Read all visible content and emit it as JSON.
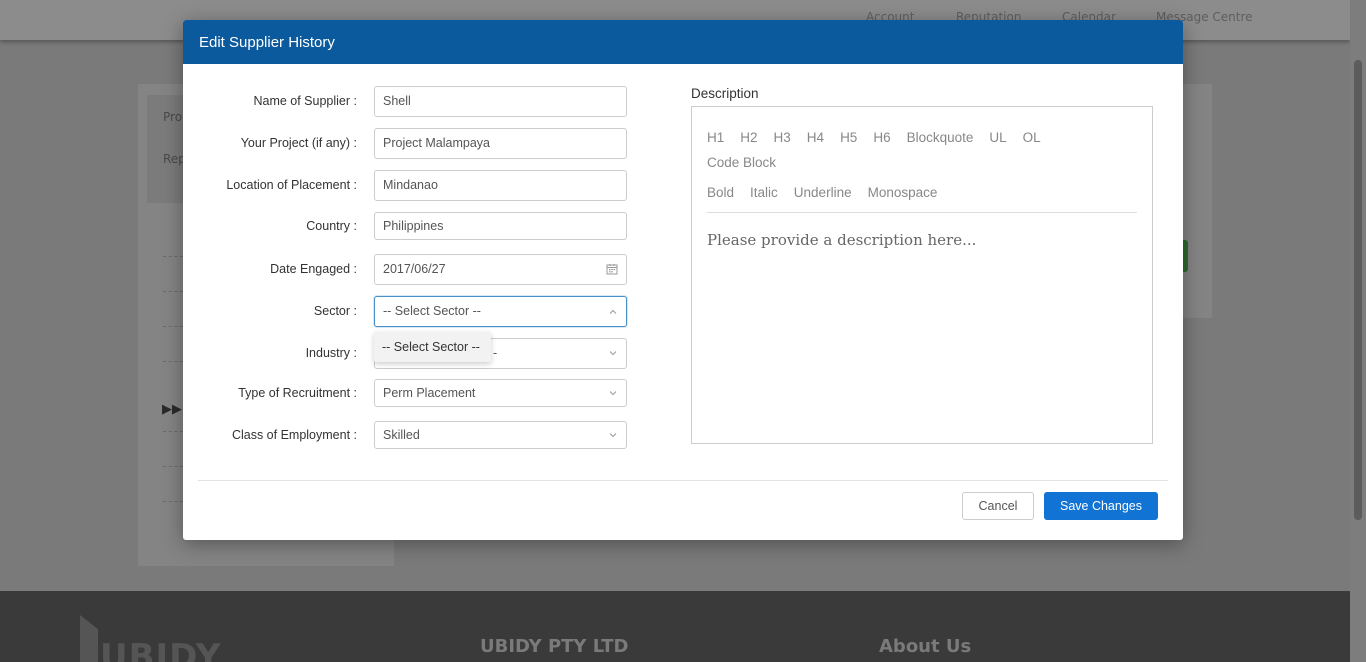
{
  "background": {
    "nav": [
      "Account",
      "Reputation",
      "Calendar",
      "Message Centre"
    ],
    "left_card": {
      "item1": "Pro",
      "item2": "Rep"
    },
    "footer": {
      "logo": "UBIDY",
      "col1": "UBIDY PTY LTD",
      "col2": "About Us"
    }
  },
  "modal": {
    "title": "Edit Supplier History",
    "fields": [
      {
        "label": "Name of Supplier :",
        "value": "Shell"
      },
      {
        "label": "Your Project (if any) :",
        "value": "Project Malampaya"
      },
      {
        "label": "Location of Placement :",
        "value": "Mindanao"
      },
      {
        "label": "Country :",
        "value": "Philippines"
      },
      {
        "label": "Date Engaged :",
        "value": "2017/06/27",
        "icon": "calendar-icon"
      },
      {
        "label": "Sector :",
        "value": "-- Select Sector --",
        "icon": "chevron-up-icon"
      },
      {
        "label": "Industry :",
        "value": "-",
        "icon": "chevron-down-icon"
      },
      {
        "label": "Type of Recruitment :",
        "value": "Perm Placement",
        "icon": "chevron-down-icon"
      },
      {
        "label": "Class of Employment :",
        "value": "Skilled",
        "icon": "chevron-down-icon"
      }
    ],
    "sector_dropdown_option": "-- Select Sector --",
    "description": {
      "label": "Description",
      "toolbar_row1": [
        "H1",
        "H2",
        "H3",
        "H4",
        "H5",
        "H6",
        "Blockquote",
        "UL",
        "OL",
        "Code Block"
      ],
      "toolbar_row2": [
        "Bold",
        "Italic",
        "Underline",
        "Monospace"
      ],
      "placeholder": "Please provide a description here..."
    },
    "buttons": {
      "cancel": "Cancel",
      "save": "Save Changes"
    },
    "colors": {
      "header": "#0c5a9e",
      "primary": "#1173d4"
    }
  }
}
